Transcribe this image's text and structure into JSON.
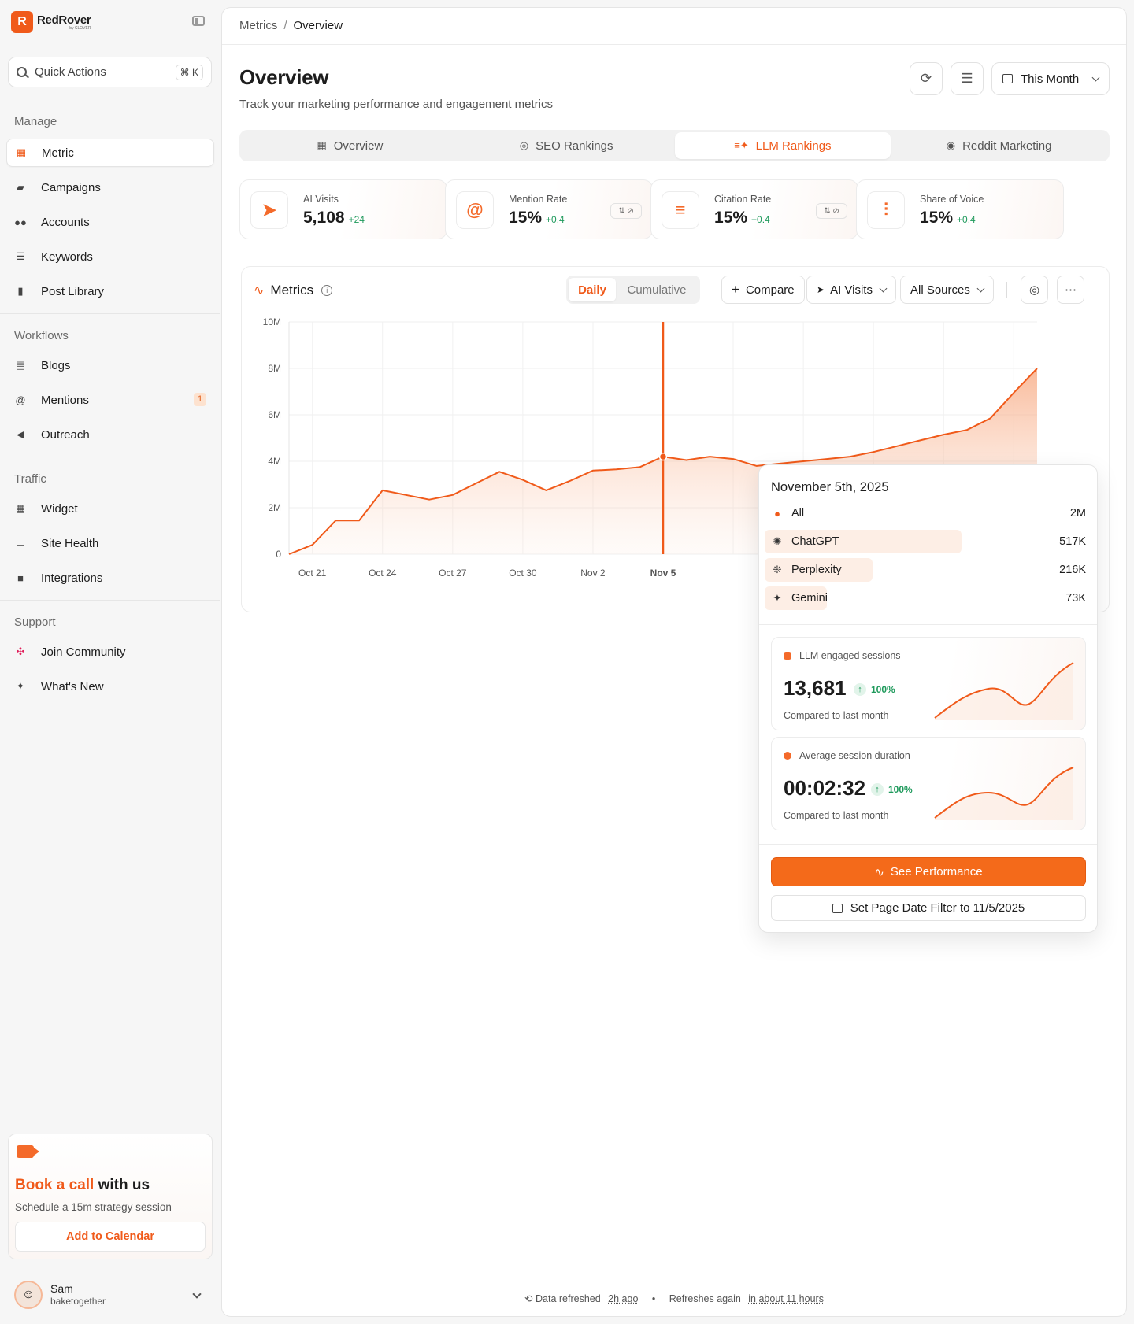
{
  "app": {
    "name": "RedRover",
    "sub": "by CLOVER"
  },
  "quick_actions": {
    "label": "Quick Actions",
    "shortcut": "⌘ K"
  },
  "sidebar": {
    "sections": [
      {
        "title": "Manage",
        "items": [
          {
            "label": "Metric",
            "icon": "grid-icon",
            "active": true
          },
          {
            "label": "Campaigns",
            "icon": "folder-icon"
          },
          {
            "label": "Accounts",
            "icon": "users-icon"
          },
          {
            "label": "Keywords",
            "icon": "keywords-icon"
          },
          {
            "label": "Post Library",
            "icon": "book-icon"
          }
        ]
      },
      {
        "title": "Workflows",
        "items": [
          {
            "label": "Blogs",
            "icon": "newspaper-icon"
          },
          {
            "label": "Mentions",
            "icon": "at-icon",
            "badge": "1"
          },
          {
            "label": "Outreach",
            "icon": "megaphone-icon"
          }
        ]
      },
      {
        "title": "Traffic",
        "items": [
          {
            "label": "Widget",
            "icon": "widget-icon"
          },
          {
            "label": "Site Health",
            "icon": "health-icon"
          },
          {
            "label": "Integrations",
            "icon": "puzzle-icon"
          }
        ]
      },
      {
        "title": "Support",
        "items": [
          {
            "label": "Join Community",
            "icon": "slack-icon"
          },
          {
            "label": "What's New",
            "icon": "sparkle-icon"
          }
        ]
      }
    ]
  },
  "promo": {
    "title_highlight": "Book a call",
    "title_rest": " with us",
    "subtitle": "Schedule a 15m strategy session",
    "button": "Add to Calendar"
  },
  "user": {
    "name": "Sam",
    "org": "baketogether"
  },
  "breadcrumb": {
    "parent": "Metrics",
    "separator": "/",
    "current": "Overview"
  },
  "header": {
    "title": "Overview",
    "subtitle": "Track your marketing performance and engagement metrics",
    "date_range": "This Month"
  },
  "tabs": [
    {
      "label": "Overview",
      "icon": "grid-icon"
    },
    {
      "label": "SEO Rankings",
      "icon": "target-icon"
    },
    {
      "label": "LLM Rankings",
      "icon": "llm-icon",
      "active": true
    },
    {
      "label": "Reddit Marketing",
      "icon": "reddit-icon"
    }
  ],
  "kpis": [
    {
      "label": "AI Visits",
      "value": "5,108",
      "delta": "+24",
      "icon": "cursor-icon"
    },
    {
      "label": "Mention Rate",
      "value": "15%",
      "delta": "+0.4",
      "icon": "at-icon",
      "pill": "⇅ ⊘"
    },
    {
      "label": "Citation Rate",
      "value": "15%",
      "delta": "+0.4",
      "icon": "citation-icon",
      "pill": "⇅ ⊘"
    },
    {
      "label": "Share of Voice",
      "value": "15%",
      "delta": "+0.4",
      "icon": "waveform-icon"
    }
  ],
  "chart_panel": {
    "title": "Metrics",
    "modes": [
      "Daily",
      "Cumulative"
    ],
    "compare": "Compare",
    "metric_select": "AI Visits",
    "source_select": "All Sources"
  },
  "chart_data": {
    "type": "area",
    "ylim": [
      0,
      10000000
    ],
    "y_ticks": [
      "0",
      "2M",
      "4M",
      "6M",
      "8M",
      "10M"
    ],
    "x_ticks": [
      "Oct 21",
      "Oct 24",
      "Oct 27",
      "Oct 30",
      "Nov 2",
      "Nov 5"
    ],
    "highlighted_x": "Nov 5",
    "x": [
      "Oct 20",
      "Oct 21",
      "Oct 22",
      "Oct 23",
      "Oct 24",
      "Oct 25",
      "Oct 26",
      "Oct 27",
      "Oct 28",
      "Oct 29",
      "Oct 30",
      "Oct 31",
      "Nov 1",
      "Nov 2",
      "Nov 3",
      "Nov 4",
      "Nov 5",
      "Nov 6",
      "Nov 7",
      "Nov 8",
      "Nov 9",
      "Nov 10",
      "Nov 11",
      "Nov 12",
      "Nov 13",
      "Nov 14",
      "Nov 15",
      "Nov 16",
      "Nov 17",
      "Nov 18",
      "Nov 19",
      "Nov 20",
      "Nov 21"
    ],
    "series": [
      {
        "values": [
          0,
          400000,
          1450000,
          1450000,
          2750000,
          2550000,
          2350000,
          2550000,
          3050000,
          3550000,
          3200000,
          2750000,
          3150000,
          3600000,
          3650000,
          3750000,
          4200000,
          4050000,
          4200000,
          4100000,
          3800000,
          3900000,
          4000000,
          4100000,
          4200000,
          4400000,
          4650000,
          4900000,
          5150000,
          5350000,
          5850000,
          6950000,
          8000000
        ]
      }
    ],
    "color": "#f05a1a"
  },
  "tooltip": {
    "date": "November 5th, 2025",
    "rows": [
      {
        "name": "All",
        "value": "2M",
        "icon": "dot-icon"
      },
      {
        "name": "ChatGPT",
        "value": "517K",
        "icon": "openai-icon",
        "share": 0.6
      },
      {
        "name": "Perplexity",
        "value": "216K",
        "icon": "perplexity-icon",
        "share": 0.33
      },
      {
        "name": "Gemini",
        "value": "73K",
        "icon": "gemini-icon",
        "share": 0.19
      }
    ],
    "cards": [
      {
        "label": "LLM engaged sessions",
        "value": "13,681",
        "change": "100%",
        "compare": "Compared to last month"
      },
      {
        "label": "Average session duration",
        "value": "00:02:32",
        "change": "100%",
        "compare": "Compared to last month"
      }
    ],
    "primary_button": "See Performance",
    "secondary_button": "Set Page Date Filter to 11/5/2025"
  },
  "footer": {
    "refreshed_label": "Data refreshed",
    "refreshed_value": "2h ago",
    "next_label": "Refreshes again",
    "next_value": "in about 11 hours"
  }
}
